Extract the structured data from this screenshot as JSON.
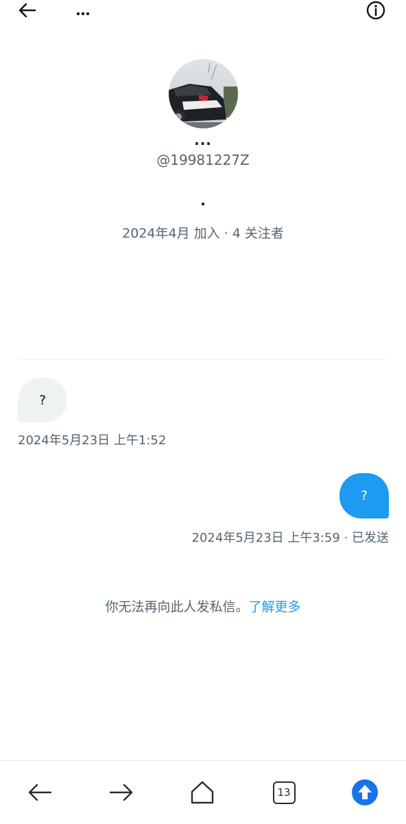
{
  "topbar": {
    "back_icon": "arrow-left-icon",
    "more_icon": "more-horizontal-icon",
    "info_icon": "info-icon"
  },
  "profile": {
    "name": "...",
    "handle": "@19981227Z",
    "bio": ".",
    "joined": "2024年4月 加入",
    "separator": " · ",
    "followers": "4 关注者"
  },
  "messages": [
    {
      "direction": "incoming",
      "text": "?",
      "timestamp": "2024年5月23日 上午1:52"
    },
    {
      "direction": "outgoing",
      "text": "?",
      "timestamp": "2024年5月23日 上午3:59",
      "status": "已发送"
    }
  ],
  "notice": {
    "text": "你无法再向此人发私信。",
    "link": "了解更多"
  },
  "browser_bar": {
    "tab_count": "13",
    "icons": [
      "back-arrow-icon",
      "forward-arrow-icon",
      "home-icon",
      "tabs-icon",
      "upload-icon"
    ],
    "accent": "#1a73e8"
  },
  "colors": {
    "accent": "#1d9bf0",
    "secondary_text": "#536471",
    "incoming_bubble": "#eff3f4"
  }
}
